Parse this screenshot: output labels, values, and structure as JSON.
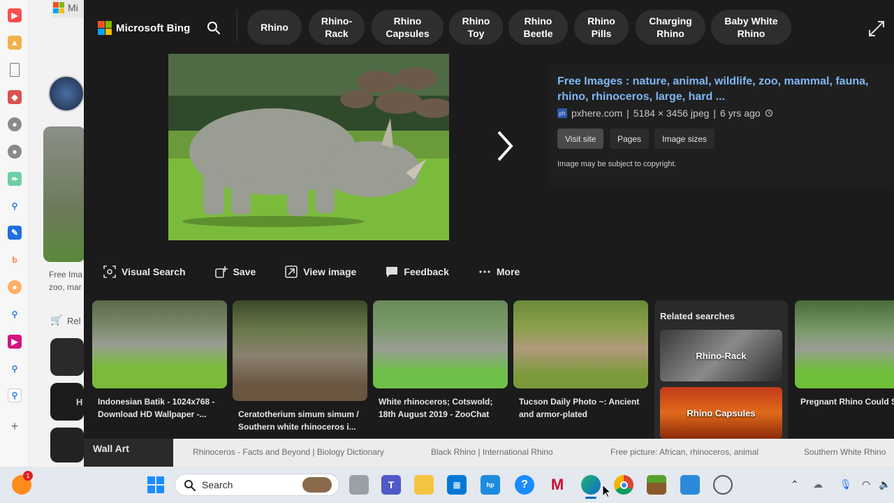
{
  "background_page": {
    "tab_title": "Mi",
    "caption_1": "Free Ima",
    "caption_2": "zoo, mar",
    "related_label": "Rel",
    "item_label": "H"
  },
  "overlay": {
    "brand": "Microsoft Bing",
    "chips": [
      "Rhino",
      "Rhino-\nRack",
      "Rhino\nCapsules",
      "Rhino\nToy",
      "Rhino\nBeetle",
      "Rhino\nPills",
      "Charging\nRhino",
      "Baby White\nRhino"
    ],
    "info": {
      "title": "Free Images : nature, animal, wildlife, zoo, mammal, fauna, rhino, rhinoceros, large, hard ...",
      "site": "pxhere.com",
      "dimensions": "5184 × 3456 jpeg",
      "age": "6 yrs ago",
      "site_icon_text": "ph",
      "visit_label": "Visit site",
      "pages_label": "Pages",
      "sizes_label": "Image sizes",
      "copyright": "Image may be subject to copyright."
    },
    "actions": {
      "visual_search": "Visual Search",
      "save": "Save",
      "view_image": "View image",
      "feedback": "Feedback",
      "more": "More"
    },
    "results": [
      {
        "caption": "Indonesian Batik - 1024x768 - Download HD Wallpaper -..."
      },
      {
        "caption": "Ceratotherium simum simum / Southern white rhinoceros i..."
      },
      {
        "caption": "White rhinoceros; Cotswold; 18th August 2019 - ZooChat"
      },
      {
        "caption": "Tucson Daily Photo ~: Ancient and armor-plated"
      },
      {
        "caption": "Pregnant Rhino Could S Nearly Extinct Relative |"
      }
    ],
    "related": {
      "title": "Related searches",
      "items": [
        "Rhino-Rack",
        "Rhino Capsules"
      ]
    },
    "bottom_strip": {
      "wall_art": "Wall Art",
      "links": [
        "Rhinoceros - Facts and Beyond | Biology Dictionary",
        "Black Rhino | International Rhino",
        "Free picture: African, rhinoceros, animal",
        "Southern White Rhino"
      ]
    }
  },
  "taskbar": {
    "search_label": "Search",
    "notification_count": "1"
  },
  "colors": {
    "link_blue": "#7fb7f5",
    "overlay_bg": "#1b1b1b",
    "chip_bg": "#2e2e2e"
  }
}
